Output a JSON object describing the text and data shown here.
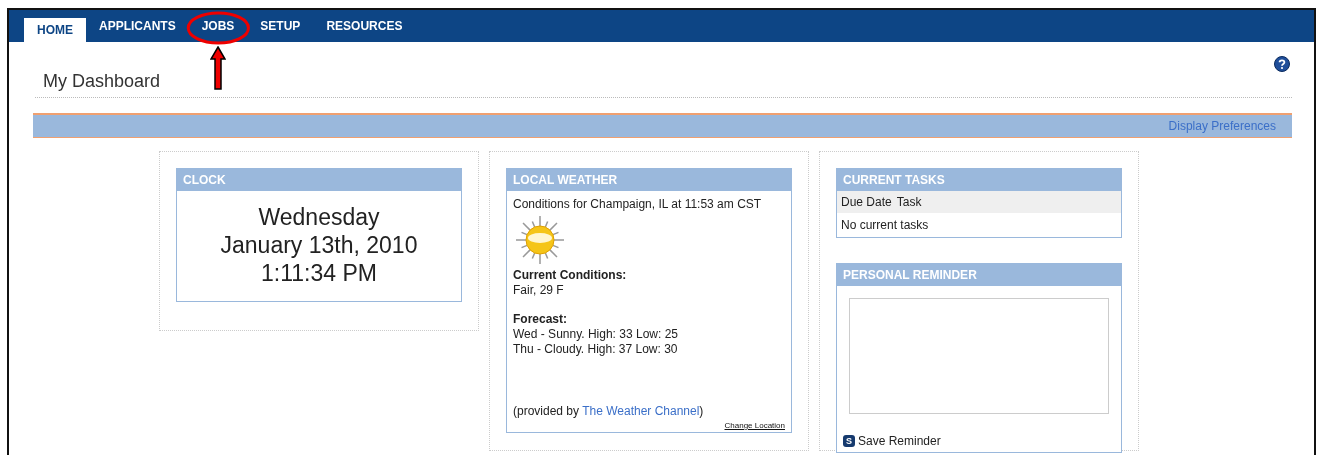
{
  "tabs": [
    {
      "label": "HOME",
      "selected": true,
      "highlighted": false
    },
    {
      "label": "APPLICANTS",
      "selected": false,
      "highlighted": false
    },
    {
      "label": "JOBS",
      "selected": false,
      "highlighted": true
    },
    {
      "label": "SETUP",
      "selected": false,
      "highlighted": false
    },
    {
      "label": "RESOURCES",
      "selected": false,
      "highlighted": false
    }
  ],
  "page_title": "My Dashboard",
  "display_preferences_link": "Display Preferences",
  "clock": {
    "title": "CLOCK",
    "day": "Wednesday",
    "date": "January 13th, 2010",
    "time": "1:11:34 PM"
  },
  "weather": {
    "title": "LOCAL WEATHER",
    "conditions_for": "Conditions for Champaign, IL at 11:53 am CST",
    "current_label": "Current Conditions:",
    "current": "Fair, 29 F",
    "forecast_label": "Forecast:",
    "forecast": [
      "Wed - Sunny. High: 33 Low: 25",
      "Thu - Cloudy. High: 37 Low: 30"
    ],
    "provided_prefix": "(provided by ",
    "provider_link": "The Weather Channel",
    "provided_suffix": ")",
    "change_location": "Change Location"
  },
  "tasks": {
    "title": "CURRENT TASKS",
    "columns": [
      "Due Date",
      "Task"
    ],
    "empty_message": "No current tasks"
  },
  "reminder": {
    "title": "PERSONAL REMINDER",
    "save_icon_letter": "S",
    "save_label": "Save Reminder"
  }
}
